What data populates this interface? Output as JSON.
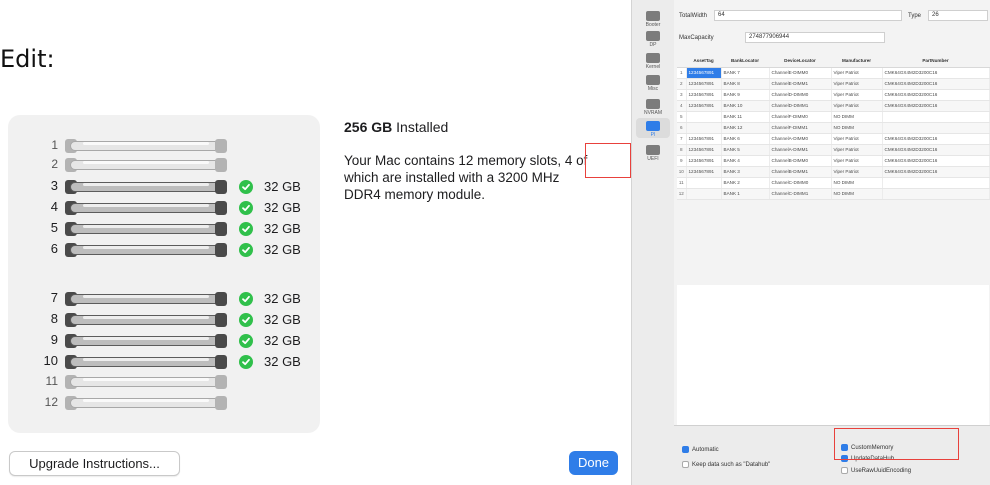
{
  "edit_label": "Edit:",
  "memory": {
    "slots": [
      {
        "num": "1",
        "filled": false,
        "size": ""
      },
      {
        "num": "2",
        "filled": false,
        "size": ""
      },
      {
        "num": "3",
        "filled": true,
        "size": "32 GB"
      },
      {
        "num": "4",
        "filled": true,
        "size": "32 GB"
      },
      {
        "num": "5",
        "filled": true,
        "size": "32 GB"
      },
      {
        "num": "6",
        "filled": true,
        "size": "32 GB"
      },
      {
        "num": "7",
        "filled": true,
        "size": "32 GB"
      },
      {
        "num": "8",
        "filled": true,
        "size": "32 GB"
      },
      {
        "num": "9",
        "filled": true,
        "size": "32 GB"
      },
      {
        "num": "10",
        "filled": true,
        "size": "32 GB"
      },
      {
        "num": "11",
        "filled": false,
        "size": ""
      },
      {
        "num": "12",
        "filled": false,
        "size": ""
      }
    ],
    "installed_amount": "256 GB",
    "installed_suffix": "Installed",
    "description": "Your Mac contains 12 memory slots, 4 of which are installed with a 3200 MHz DDR4 memory module.",
    "upgrade_button": "Upgrade Instructions...",
    "done_button": "Done"
  },
  "colors": {
    "accent": "#2f7de8",
    "check": "#30c04b",
    "highlight_box": "#e8413c"
  },
  "opencore": {
    "sidebar": [
      {
        "label": "Booter",
        "icon": "booter-icon",
        "active": false
      },
      {
        "label": "DP",
        "icon": "device-properties-icon",
        "active": false
      },
      {
        "label": "Kernel",
        "icon": "kernel-icon",
        "active": false
      },
      {
        "label": "Misc",
        "icon": "misc-icon",
        "active": false
      },
      {
        "label": "NVRAM",
        "icon": "nvram-icon",
        "active": false
      },
      {
        "label": "PI",
        "icon": "platform-info-icon",
        "active": true
      },
      {
        "label": "UEFI",
        "icon": "uefi-icon",
        "active": false
      }
    ],
    "fields": {
      "total_width_label": "TotalWidth",
      "total_width_value": "64",
      "type_label": "Type",
      "type_value": "26",
      "max_capacity_label": "MaxCapacity",
      "max_capacity_value": "274877906944"
    },
    "table": {
      "columns": [
        "",
        "AssetTag",
        "BankLocator",
        "DeviceLocator",
        "Manufacturer",
        "PartNumber"
      ],
      "rows": [
        [
          "1",
          "1234567891",
          "BANK 7",
          "ChannelE-DIMM0",
          "Viper Patriot",
          "CMK64GX4M2D3200C16"
        ],
        [
          "2",
          "1234567891",
          "BANK 8",
          "ChannelE-DIMM1",
          "Viper Patriot",
          "CMK64GX4M2D3200C16"
        ],
        [
          "3",
          "1234567891",
          "BANK 9",
          "ChannelD-DIMM0",
          "Viper Patriot",
          "CMK64GX4M2D3200C16"
        ],
        [
          "4",
          "1234567891",
          "BANK 10",
          "ChannelD-DIMM1",
          "Viper Patriot",
          "CMK64GX4M2D3200C16"
        ],
        [
          "5",
          "",
          "BANK 11",
          "ChannelF-DIMM0",
          "NO DIMM",
          ""
        ],
        [
          "6",
          "",
          "BANK 12",
          "ChannelF-DIMM1",
          "NO DIMM",
          ""
        ],
        [
          "7",
          "1234567891",
          "BANK 6",
          "ChannelA-DIMM0",
          "Viper Patriot",
          "CMK64GX4M2D3200C16"
        ],
        [
          "8",
          "1234567891",
          "BANK 5",
          "ChannelA-DIMM1",
          "Viper Patriot",
          "CMK64GX4M2D3200C16"
        ],
        [
          "9",
          "1234567891",
          "BANK 4",
          "ChannelB-DIMM0",
          "Viper Patriot",
          "CMK64GX4M2D3200C16"
        ],
        [
          "10",
          "1234567891",
          "BANK 3",
          "ChannelB-DIMM1",
          "Viper Patriot",
          "CMK64GX4M2D3200C16"
        ],
        [
          "11",
          "",
          "BANK 2",
          "ChannelC-DIMM0",
          "NO DIMM",
          ""
        ],
        [
          "12",
          "",
          "BANK 1",
          "ChannelC-DIMM1",
          "NO DIMM",
          ""
        ]
      ]
    },
    "checkboxes": [
      {
        "label": "Automatic",
        "checked": true
      },
      {
        "label": "Keep data such as \"Datahub\"",
        "checked": false
      },
      {
        "label": "CustomMemory",
        "checked": true
      },
      {
        "label": "UpdateDataHub",
        "checked": true
      },
      {
        "label": "UseRawUuidEncoding",
        "checked": false
      }
    ]
  }
}
